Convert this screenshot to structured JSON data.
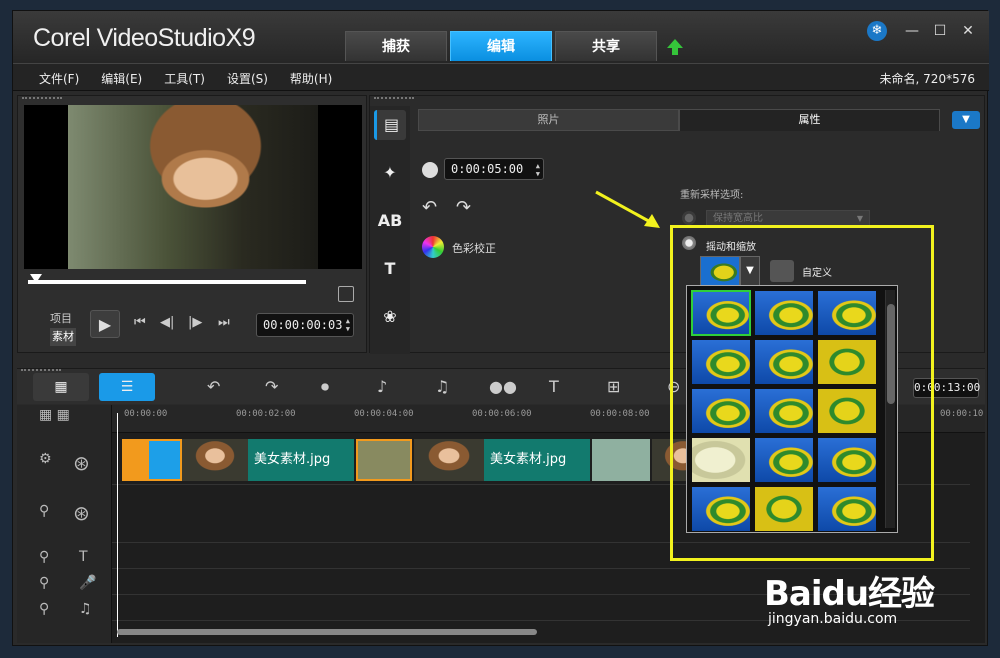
{
  "app": {
    "brand": "Corel VideoStudioX9",
    "project_info": "未命名, 720*576"
  },
  "tabs": [
    "捕获",
    "编辑",
    "共享"
  ],
  "menu": [
    "文件(F)",
    "编辑(E)",
    "工具(T)",
    "设置(S)",
    "帮助(H)"
  ],
  "preview": {
    "project_label": "项目",
    "clip_label": "素材",
    "timecode": "00:00:00:03"
  },
  "options": {
    "tabs": [
      "照片",
      "属性"
    ],
    "duration": "0:00:05:00",
    "color_correction": "色彩校正",
    "resample_label": "重新采样选项:",
    "keep_aspect": "保持宽高比",
    "pan_zoom": "摇动和缩放",
    "custom": "自定义"
  },
  "timeline": {
    "ruler": [
      "00:00:00",
      "00:00:02:00",
      "00:00:04:00",
      "00:00:06:00",
      "00:00:08:00",
      "00:00:10"
    ],
    "time_display": "0:00:13:00",
    "clip_name": "美女素材.jpg"
  },
  "watermark": {
    "main": "Baidu经验",
    "sub": "jingyan.baidu.com"
  },
  "colors": {
    "accent": "#1a9ae8",
    "highlight": "#f2f21e",
    "clip_label": "#127a6e",
    "transition": "#f29a1d"
  }
}
